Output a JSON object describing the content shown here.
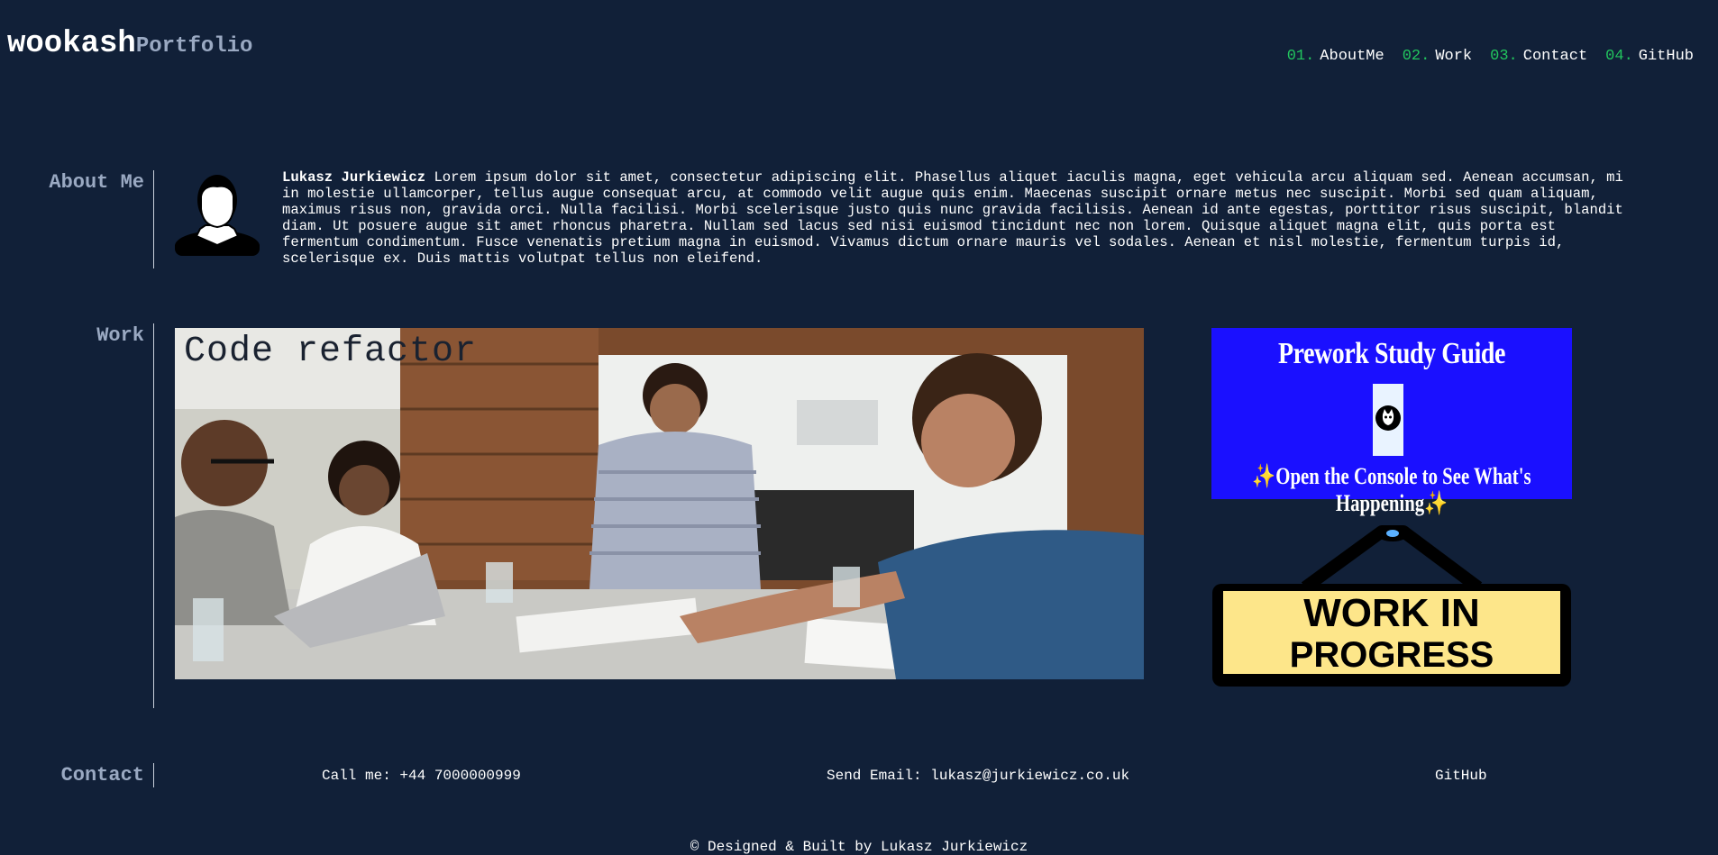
{
  "header": {
    "brand_main": "wookash",
    "brand_sub": "Portfolio"
  },
  "nav": [
    {
      "num": "01.",
      "label": "AboutMe"
    },
    {
      "num": "02.",
      "label": "Work"
    },
    {
      "num": "03.",
      "label": "Contact"
    },
    {
      "num": "04.",
      "label": "GitHub"
    }
  ],
  "about": {
    "title": "About Me",
    "name": "Lukasz Jurkiewicz",
    "text": "Lorem ipsum dolor sit amet, consectetur adipiscing elit. Phasellus aliquet iaculis magna, eget vehicula arcu aliquam sed. Aenean accumsan, mi in molestie ullamcorper, tellus augue consequat arcu, at commodo velit augue quis enim. Maecenas suscipit ornare metus nec suscipit. Morbi sed quam aliquam, maximus risus non, gravida orci. Nulla facilisi. Morbi scelerisque justo quis nunc gravida facilisis. Aenean id ante egestas, porttitor risus suscipit, blandit diam. Ut posuere augue sit amet rhoncus pharetra. Nullam sed lacus sed nisi euismod tincidunt nec non lorem. Quisque aliquet magna elit, quis porta est fermentum condimentum. Fusce venenatis pretium magna in euismod. Vivamus dictum ornare mauris vel sodales. Aenean et nisl molestie, fermentum turpis id, scelerisque ex. Duis mattis volutpat tellus non eleifend."
  },
  "work": {
    "title": "Work",
    "featured_title": "Code refactor",
    "prework_title": "Prework Study Guide",
    "prework_subtitle": "Open the Console to See What's Happening",
    "prework_sparkle": "✨",
    "wip_line1": "WORK IN",
    "wip_line2": "PROGRESS"
  },
  "contact": {
    "title": "Contact",
    "phone": "Call me: +44 7000000999",
    "email": "Send Email: lukasz@jurkiewicz.co.uk",
    "github": "GitHub"
  },
  "footer": {
    "text": "© Designed & Built by Lukasz Jurkiewicz"
  },
  "colors": {
    "background": "#112038",
    "nav_number": "#22c55e",
    "section_title": "#9aa9c2",
    "prework_blue": "#1a10ff",
    "wip_yellow": "#fde68a"
  }
}
